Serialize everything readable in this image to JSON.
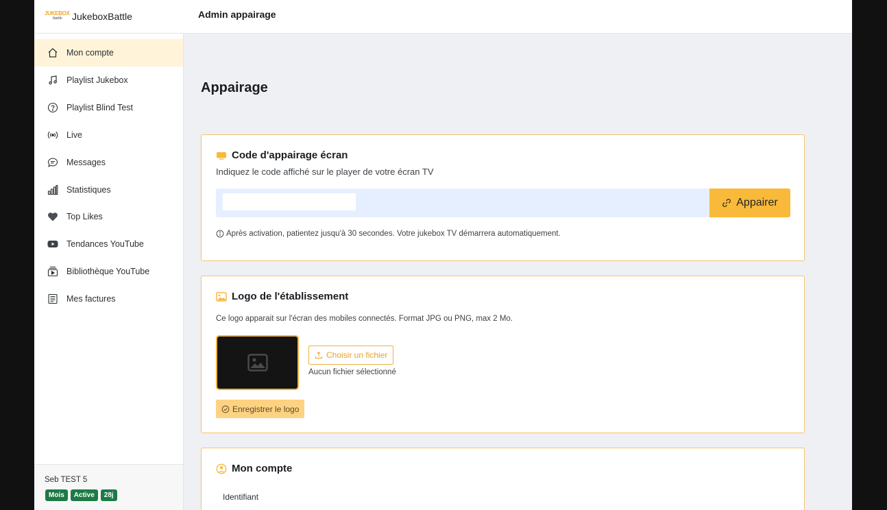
{
  "brand": {
    "logo_top": "JUKEBOX",
    "logo_bottom": "battle",
    "name": "JukeboxBattle"
  },
  "header": {
    "title": "Admin appairage"
  },
  "sidebar": {
    "items": [
      {
        "label": "Mon compte",
        "icon": "home-icon",
        "active": true
      },
      {
        "label": "Playlist Jukebox",
        "icon": "music-note-icon"
      },
      {
        "label": "Playlist Blind Test",
        "icon": "question-circle-icon"
      },
      {
        "label": "Live",
        "icon": "broadcast-icon"
      },
      {
        "label": "Messages",
        "icon": "chat-icon"
      },
      {
        "label": "Statistiques",
        "icon": "bar-chart-icon"
      },
      {
        "label": "Top Likes",
        "icon": "heart-icon"
      },
      {
        "label": "Tendances YouTube",
        "icon": "youtube-icon"
      },
      {
        "label": "Bibliothèque YouTube",
        "icon": "collection-play-icon"
      },
      {
        "label": "Mes factures",
        "icon": "receipt-icon"
      }
    ],
    "user": {
      "name": "Seb TEST 5",
      "badges": [
        "Mois",
        "Active",
        "28j"
      ]
    }
  },
  "main": {
    "title": "Appairage",
    "pairing": {
      "title": "Code d'appairage écran",
      "subtitle": "Indiquez le code affiché sur le player de votre écran TV",
      "input_value": "",
      "button_label": "Appairer",
      "note": "Après activation, patientez jusqu'à 30 secondes. Votre jukebox TV démarrera automatiquement."
    },
    "logo": {
      "title": "Logo de l'établissement",
      "subtitle": "Ce logo apparait sur l'écran des mobiles connectés. Format JPG ou PNG, max 2 Mo.",
      "choose_label": "Choisir un fichier",
      "file_status": "Aucun fichier sélectionné",
      "save_label": "Enregistrer le logo"
    },
    "account": {
      "title": "Mon compte",
      "identifier_label": "Identifiant"
    }
  },
  "colors": {
    "accent": "#f9b93a",
    "badge": "#1e7a45",
    "active_nav": "#fff4d9",
    "pair_row": "#e6efff"
  }
}
